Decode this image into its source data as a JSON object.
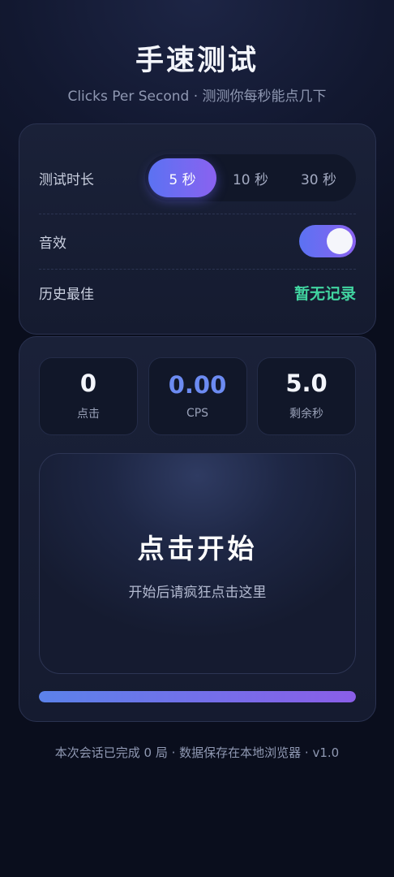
{
  "header": {
    "title": "手速测试",
    "subtitle": "Clicks Per Second · 测测你每秒能点几下"
  },
  "settings": {
    "duration_label": "测试时长",
    "duration_options": [
      "5 秒",
      "10 秒",
      "30 秒"
    ],
    "duration_selected": "5 秒",
    "sound_label": "音效",
    "sound_on": true,
    "best_label": "历史最佳",
    "best_value": "暂无记录"
  },
  "stats": {
    "clicks_value": "0",
    "clicks_label": "点击",
    "cps_value": "0.00",
    "cps_label": "CPS",
    "remaining_value": "5.0",
    "remaining_label": "剩余秒"
  },
  "click_area": {
    "title": "点击开始",
    "hint": "开始后请疯狂点击这里"
  },
  "progress": {
    "fraction": 1.0
  },
  "footer": {
    "text": "本次会话已完成 0 局 · 数据保存在本地浏览器 · v1.0"
  },
  "colors": {
    "accent_start": "#5b72f2",
    "accent_end": "#8a62f0",
    "best_value": "#41d4a0",
    "cps_value": "#6c8bf2"
  }
}
